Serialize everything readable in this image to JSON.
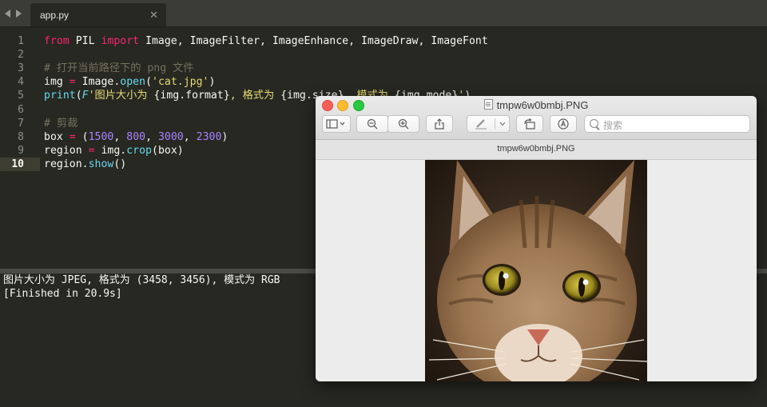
{
  "editor": {
    "tab": {
      "filename": "app.py",
      "close_glyph": "✕"
    },
    "code_lines": [
      {
        "n": "1",
        "parts": [
          {
            "t": "from",
            "c": "kw"
          },
          {
            "t": " PIL ",
            "c": ""
          },
          {
            "t": "import",
            "c": "kw"
          },
          {
            "t": " Image, ImageFilter, ImageEnhance, ImageDraw, ImageFont",
            "c": ""
          }
        ]
      },
      {
        "n": "2",
        "parts": []
      },
      {
        "n": "3",
        "parts": [
          {
            "t": "# 打开当前路径下的 png 文件",
            "c": "cmt"
          }
        ]
      },
      {
        "n": "4",
        "parts": [
          {
            "t": "img ",
            "c": ""
          },
          {
            "t": "=",
            "c": "kw"
          },
          {
            "t": " Image.",
            "c": ""
          },
          {
            "t": "open",
            "c": "fn"
          },
          {
            "t": "(",
            "c": ""
          },
          {
            "t": "'cat.jpg'",
            "c": "str"
          },
          {
            "t": ")",
            "c": ""
          }
        ]
      },
      {
        "n": "5",
        "parts": [
          {
            "t": "print",
            "c": "fn"
          },
          {
            "t": "(",
            "c": ""
          },
          {
            "t": "F",
            "c": "it"
          },
          {
            "t": "'图片大小为 ",
            "c": "str"
          },
          {
            "t": "{img.format}",
            "c": ""
          },
          {
            "t": ", 格式为 ",
            "c": "str"
          },
          {
            "t": "{img.size}",
            "c": ""
          },
          {
            "t": ", 模式为 ",
            "c": "str"
          },
          {
            "t": "{img.mode}",
            "c": ""
          },
          {
            "t": "'",
            "c": "str"
          },
          {
            "t": ")",
            "c": ""
          }
        ]
      },
      {
        "n": "6",
        "parts": []
      },
      {
        "n": "7",
        "parts": [
          {
            "t": "# 剪裁",
            "c": "cmt"
          }
        ]
      },
      {
        "n": "8",
        "parts": [
          {
            "t": "box ",
            "c": ""
          },
          {
            "t": "=",
            "c": "kw"
          },
          {
            "t": " (",
            "c": ""
          },
          {
            "t": "1500",
            "c": "num"
          },
          {
            "t": ", ",
            "c": ""
          },
          {
            "t": "800",
            "c": "num"
          },
          {
            "t": ", ",
            "c": ""
          },
          {
            "t": "3000",
            "c": "num"
          },
          {
            "t": ", ",
            "c": ""
          },
          {
            "t": "2300",
            "c": "num"
          },
          {
            "t": ")",
            "c": ""
          }
        ]
      },
      {
        "n": "9",
        "parts": [
          {
            "t": "region ",
            "c": ""
          },
          {
            "t": "=",
            "c": "kw"
          },
          {
            "t": " img.",
            "c": ""
          },
          {
            "t": "crop",
            "c": "fn"
          },
          {
            "t": "(box)",
            "c": ""
          }
        ]
      },
      {
        "n": "10",
        "parts": [
          {
            "t": "region.",
            "c": ""
          },
          {
            "t": "show",
            "c": "fn"
          },
          {
            "t": "()",
            "c": ""
          }
        ]
      }
    ],
    "active_line": "10"
  },
  "output": {
    "lines": [
      "图片大小为 JPEG, 格式为 (3458, 3456), 模式为 RGB",
      "[Finished in 20.9s]"
    ]
  },
  "preview_window": {
    "title": "tmpw6w0bmbj.PNG",
    "subtitle": "tmpw6w0bmbj.PNG",
    "search_placeholder": "搜索",
    "toolbar_icons": [
      "sidebar-icon",
      "zoom-out-icon",
      "zoom-in-icon",
      "share-icon",
      "markup-pen-icon",
      "rotate-icon",
      "annotate-icon",
      "search-icon"
    ],
    "photo_subject": "cat-face-photo"
  },
  "colors": {
    "editor_bg": "#272822",
    "keyword": "#f92672",
    "function": "#66d9ef",
    "string": "#e6db74",
    "number": "#ae81ff",
    "comment": "#75715e"
  }
}
